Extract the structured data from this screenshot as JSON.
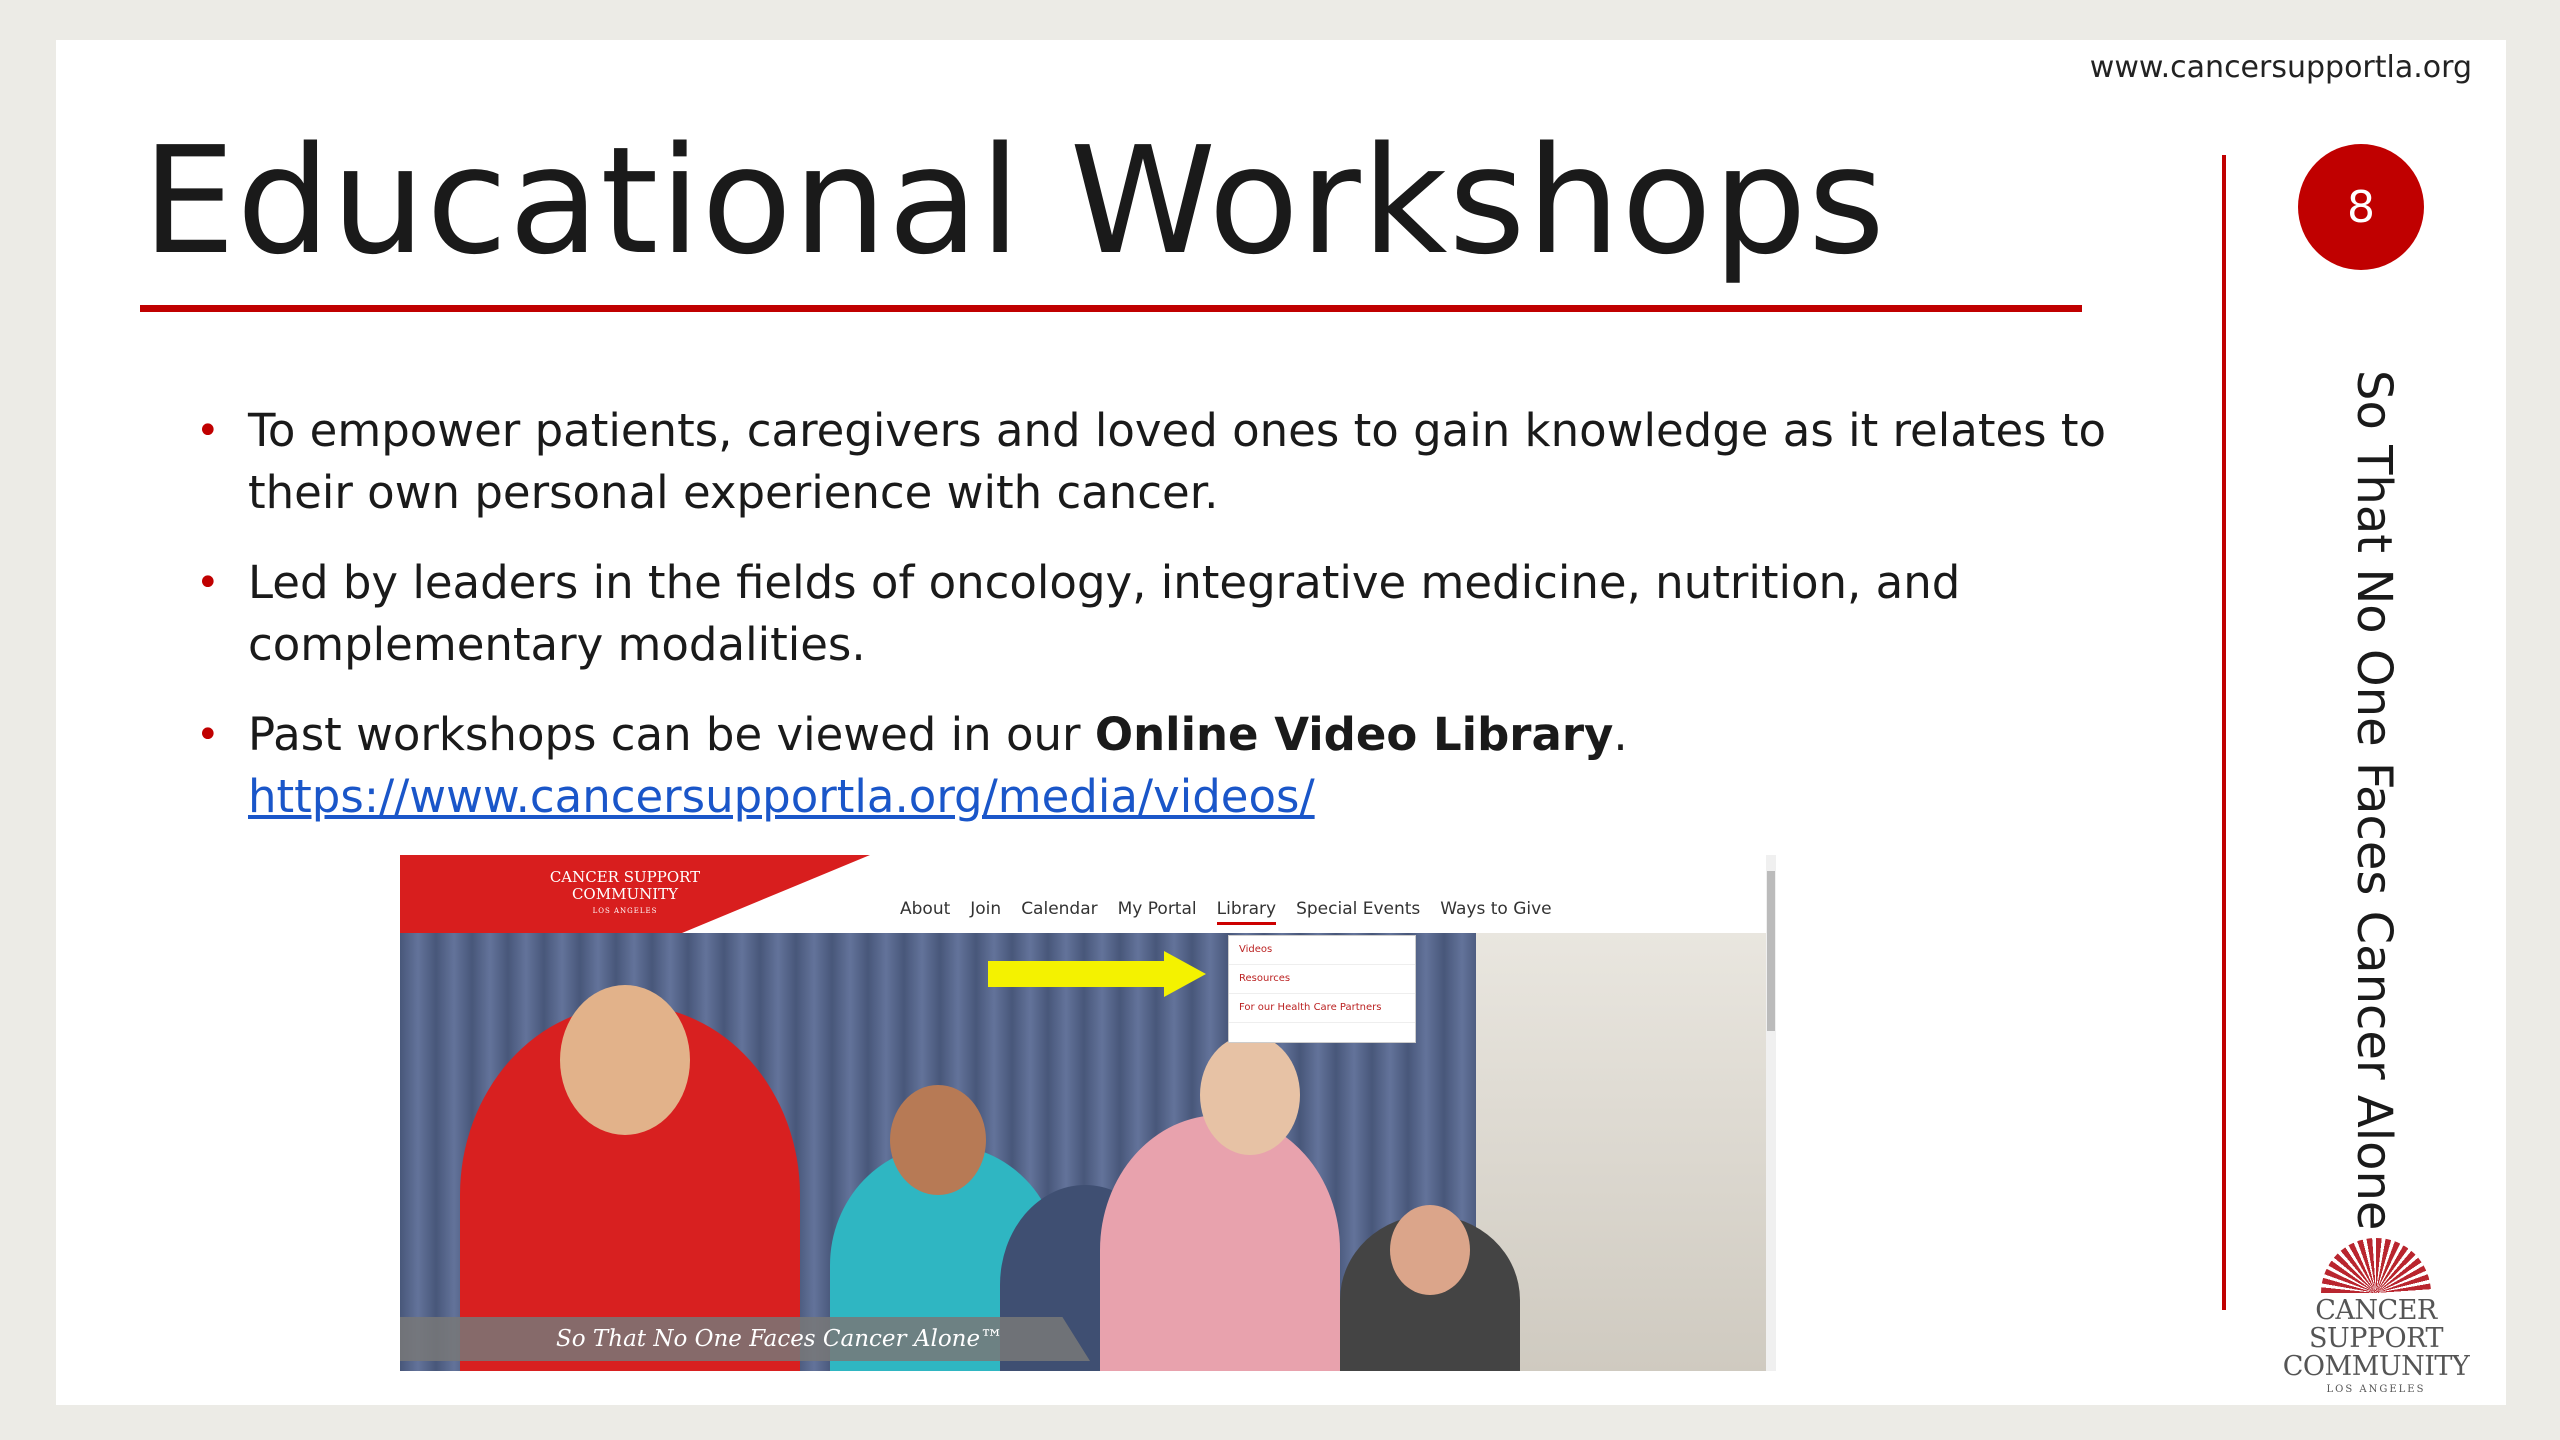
{
  "header": {
    "site_url": "www.cancersupportla.org",
    "title": "Educational Workshops",
    "page_number": "8"
  },
  "sidebar": {
    "tagline": "So That No One Faces Cancer Alone"
  },
  "bullets": [
    {
      "text": "To empower patients, caregivers and loved ones to gain knowledge as it relates to their own personal experience with cancer."
    },
    {
      "text": "Led by leaders in the fields of oncology, integrative medicine, nutrition, and complementary modalities."
    },
    {
      "text_before": "Past workshops can be viewed in our ",
      "bold": "Online Video Library",
      "text_after": ".",
      "link": "https://www.cancersupportla.org/media/videos/"
    }
  ],
  "screenshot": {
    "logo_line1": "CANCER SUPPORT",
    "logo_line2": "COMMUNITY",
    "logo_line3": "LOS ANGELES",
    "nav": [
      "About",
      "Join",
      "Calendar",
      "My Portal",
      "Library",
      "Special Events",
      "Ways to Give"
    ],
    "dropdown": [
      "Videos",
      "Resources",
      "For our Health Care Partners"
    ],
    "banner": "So That No One Faces Cancer Alone™"
  },
  "footer_logo": {
    "line1": "CANCER SUPPORT",
    "line2": "COMMUNITY",
    "line3": "LOS ANGELES"
  },
  "colors": {
    "accent_red": "#c00000",
    "link_blue": "#1a56c9",
    "arrow_yellow": "#f4f200"
  }
}
